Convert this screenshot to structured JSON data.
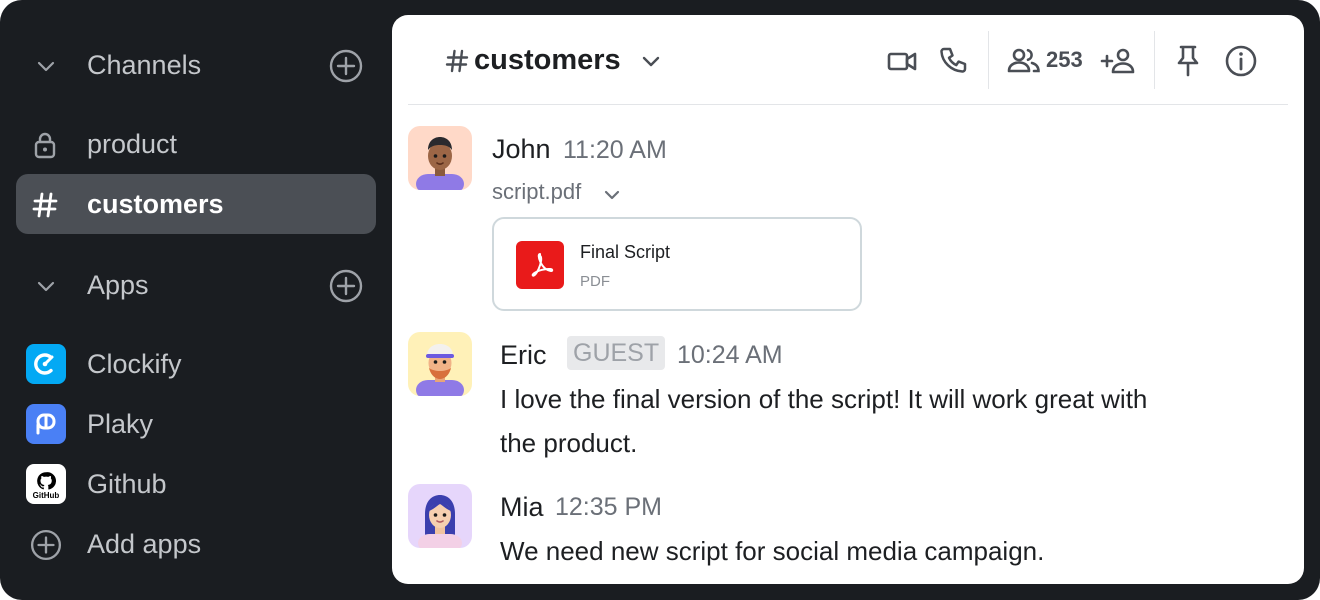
{
  "sidebar": {
    "channels_label": "Channels",
    "channels": [
      {
        "label": "product",
        "icon": "lock-icon",
        "active": false
      },
      {
        "label": "customers",
        "icon": "hash-icon",
        "active": true
      }
    ],
    "apps_label": "Apps",
    "apps": [
      {
        "label": "Clockify",
        "icon": "clockify-icon",
        "color": "#03a9f4"
      },
      {
        "label": "Plaky",
        "icon": "plaky-icon",
        "color": "#4a80f5"
      },
      {
        "label": "Github",
        "icon": "github-icon",
        "color": "#ffffff",
        "badge_text": "GitHub"
      }
    ],
    "add_apps_label": "Add apps"
  },
  "header": {
    "channel_name": "customers",
    "member_count": "253"
  },
  "messages": [
    {
      "author": "John",
      "time": "11:20 AM",
      "file_name": "script.pdf",
      "attachment": {
        "title": "Final Script",
        "type": "PDF"
      }
    },
    {
      "author": "Eric",
      "badge": "GUEST",
      "time": "10:24 AM",
      "text_line1": "I love the final version of the script! It will work great with",
      "text_line2": "the product."
    },
    {
      "author": "Mia",
      "time": "12:35 PM",
      "text": "We need new script for social media campaign."
    }
  ],
  "colors": {
    "sidebar_bg": "#1a1d21",
    "active_item_bg": "#4b4f55",
    "pdf_red": "#e91a1a"
  }
}
